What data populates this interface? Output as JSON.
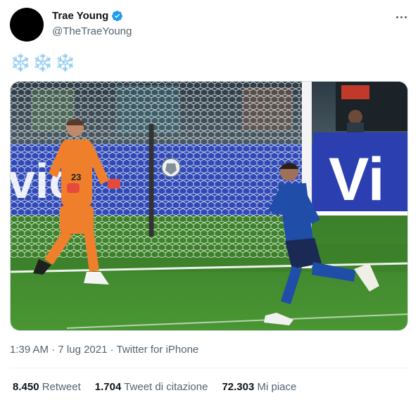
{
  "user": {
    "display_name": "Trae Young",
    "handle": "@TheTraeYoung",
    "verified": true
  },
  "tweet": {
    "text": "❄️❄️❄️"
  },
  "meta": {
    "time": "1:39 AM",
    "separator": " · ",
    "date": "7 lug 2021",
    "source": "Twitter for iPhone"
  },
  "stats": {
    "retweets": {
      "count": "8.450",
      "label": "Retweet"
    },
    "quotes": {
      "count": "1.704",
      "label": "Tweet di citazione"
    },
    "likes": {
      "count": "72.303",
      "label": "Mi piace"
    }
  },
  "photo": {
    "board_text": "Vi",
    "board_text_left": "vic",
    "goalkeeper_number": "23"
  },
  "colors": {
    "verified": "#1d9bf0",
    "secondary_text": "#536471",
    "pitch": "#3f8a2a",
    "italy_blue": "#1f4da8",
    "keeper_orange": "#f07f2c"
  }
}
